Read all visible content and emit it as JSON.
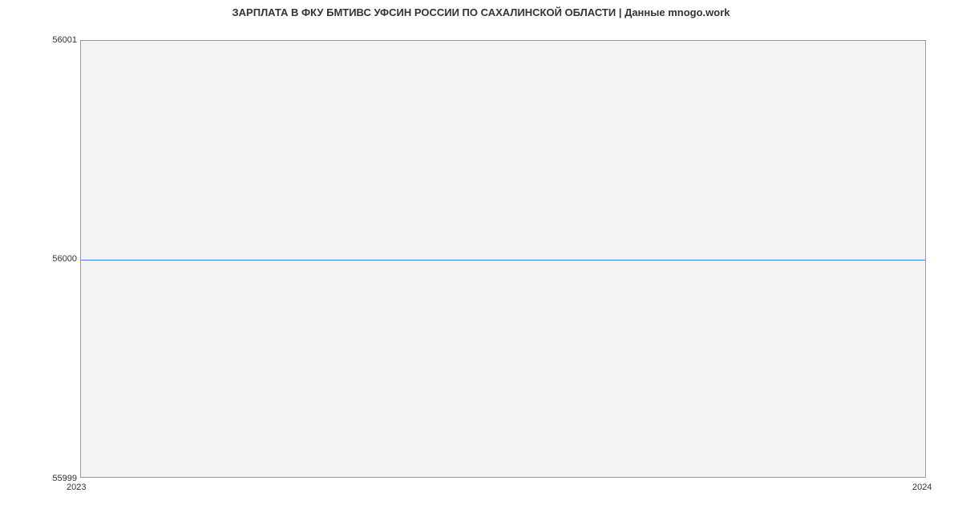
{
  "chart_data": {
    "type": "line",
    "title": "ЗАРПЛАТА В ФКУ БМТИВС УФСИН РОССИИ ПО САХАЛИНСКОЙ ОБЛАСТИ | Данные mnogo.work",
    "xlabel": "",
    "ylabel": "",
    "x": [
      2023,
      2024
    ],
    "values": [
      56000,
      56000
    ],
    "y_ticks": [
      55999,
      56000,
      56001
    ],
    "x_ticks": [
      2023,
      2024
    ],
    "ylim": [
      55999,
      56001
    ],
    "xlim": [
      2023,
      2024
    ]
  },
  "labels": {
    "y_56001": "56001",
    "y_56000": "56000",
    "y_55999": "55999",
    "x_2023": "2023",
    "x_2024": "2024"
  }
}
